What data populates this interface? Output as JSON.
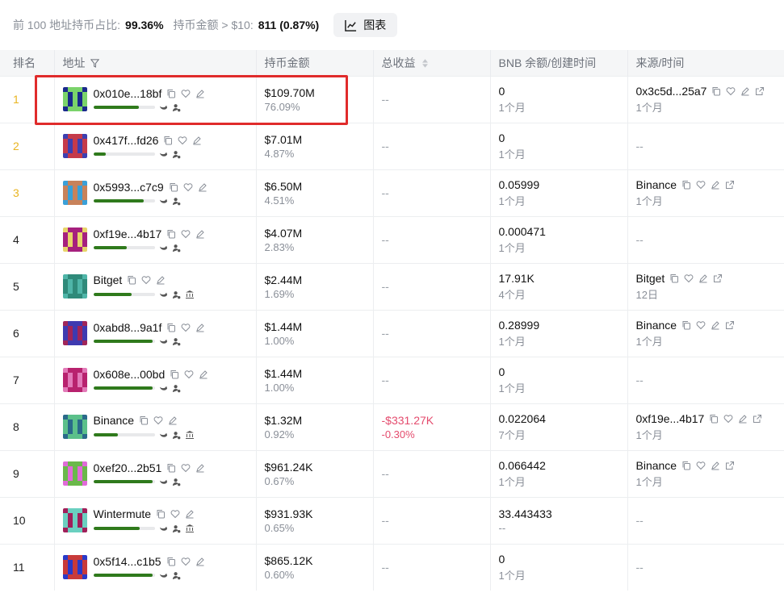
{
  "summary": {
    "top_label": "前 100 地址持币占比:",
    "top_value": "99.36%",
    "over_label": "持币金额 > $10:",
    "over_value": "811 (0.87%)",
    "chart_button": "图表"
  },
  "columns": {
    "rank": "排名",
    "address": "地址",
    "holding": "持币金额",
    "pnl": "总收益",
    "bnb": "BNB 余额/创建时间",
    "source": "来源/时间"
  },
  "colors": {
    "bar": "#2f7a1c",
    "gold_rank": "#e9b521",
    "negative": "#e44b6d",
    "highlight": "#e02b2b"
  },
  "rows": [
    {
      "rank": "1",
      "address": "0x010e...18bf",
      "bar_pct": 74,
      "bank": false,
      "holding": "$109.70M",
      "holding_pct": "76.09%",
      "pnl": "--",
      "pnl_pct": "",
      "bnb": "0",
      "bnb_time": "1个月",
      "source": "0x3c5d...25a7",
      "source_time": "1个月",
      "avatar": [
        "#1a2a8c",
        "#7ad36a",
        "#1a2a8c"
      ]
    },
    {
      "rank": "2",
      "address": "0x417f...fd26",
      "bar_pct": 20,
      "bank": false,
      "holding": "$7.01M",
      "holding_pct": "4.87%",
      "pnl": "--",
      "pnl_pct": "",
      "bnb": "0",
      "bnb_time": "1个月",
      "source": "--",
      "source_time": "",
      "avatar": [
        "#3d3fb0",
        "#c53a4a",
        "#3d3fb0"
      ]
    },
    {
      "rank": "3",
      "address": "0x5993...c7c9",
      "bar_pct": 82,
      "bank": false,
      "holding": "$6.50M",
      "holding_pct": "4.51%",
      "pnl": "--",
      "pnl_pct": "",
      "bnb": "0.05999",
      "bnb_time": "1个月",
      "source": "Binance",
      "source_time": "1个月",
      "avatar": [
        "#3aa0d8",
        "#c8825a",
        "#3aa0d8"
      ]
    },
    {
      "rank": "4",
      "address": "0xf19e...4b17",
      "bar_pct": 55,
      "bank": false,
      "holding": "$4.07M",
      "holding_pct": "2.83%",
      "pnl": "--",
      "pnl_pct": "",
      "bnb": "0.000471",
      "bnb_time": "1个月",
      "source": "--",
      "source_time": "",
      "avatar": [
        "#e8d46a",
        "#a6207e",
        "#e8d46a"
      ]
    },
    {
      "rank": "5",
      "address": "Bitget",
      "bar_pct": 62,
      "bank": true,
      "holding": "$2.44M",
      "holding_pct": "1.69%",
      "pnl": "--",
      "pnl_pct": "",
      "bnb": "17.91K",
      "bnb_time": "4个月",
      "source": "Bitget",
      "source_time": "12日",
      "avatar": [
        "#4fb5a8",
        "#2f8a7a",
        "#4fb5a8"
      ]
    },
    {
      "rank": "6",
      "address": "0xabd8...9a1f",
      "bar_pct": 97,
      "bank": false,
      "holding": "$1.44M",
      "holding_pct": "1.00%",
      "pnl": "--",
      "pnl_pct": "",
      "bnb": "0.28999",
      "bnb_time": "1个月",
      "source": "Binance",
      "source_time": "1个月",
      "avatar": [
        "#a0255a",
        "#3e3ab0",
        "#a0255a"
      ]
    },
    {
      "rank": "7",
      "address": "0x608e...00bd",
      "bar_pct": 97,
      "bank": false,
      "holding": "$1.44M",
      "holding_pct": "1.00%",
      "pnl": "--",
      "pnl_pct": "",
      "bnb": "0",
      "bnb_time": "1个月",
      "source": "--",
      "source_time": "",
      "avatar": [
        "#e27ab8",
        "#b8226e",
        "#e27ab8"
      ]
    },
    {
      "rank": "8",
      "address": "Binance",
      "bar_pct": 40,
      "bank": true,
      "holding": "$1.32M",
      "holding_pct": "0.92%",
      "pnl": "-$331.27K",
      "pnl_pct": "-0.30%",
      "bnb": "0.022064",
      "bnb_time": "7个月",
      "source": "0xf19e...4b17",
      "source_time": "1个月",
      "avatar": [
        "#2a6a8a",
        "#5bc08a",
        "#2a6a8a"
      ]
    },
    {
      "rank": "9",
      "address": "0xef20...2b51",
      "bar_pct": 97,
      "bank": false,
      "holding": "$961.24K",
      "holding_pct": "0.67%",
      "pnl": "--",
      "pnl_pct": "",
      "bnb": "0.066442",
      "bnb_time": "1个月",
      "source": "Binance",
      "source_time": "1个月",
      "avatar": [
        "#e06ad8",
        "#6ab84a",
        "#e06ad8"
      ]
    },
    {
      "rank": "10",
      "address": "Wintermute",
      "bar_pct": 76,
      "bank": true,
      "holding": "$931.93K",
      "holding_pct": "0.65%",
      "pnl": "--",
      "pnl_pct": "",
      "bnb": "33.443433",
      "bnb_time": "--",
      "source": "--",
      "source_time": "",
      "avatar": [
        "#a0205a",
        "#6ad0c0",
        "#a0205a"
      ]
    },
    {
      "rank": "11",
      "address": "0x5f14...c1b5",
      "bar_pct": 97,
      "bank": false,
      "holding": "$865.12K",
      "holding_pct": "0.60%",
      "pnl": "--",
      "pnl_pct": "",
      "bnb": "0",
      "bnb_time": "1个月",
      "source": "--",
      "source_time": "",
      "avatar": [
        "#2a3ac8",
        "#c83a3a",
        "#2a3ac8"
      ]
    }
  ]
}
